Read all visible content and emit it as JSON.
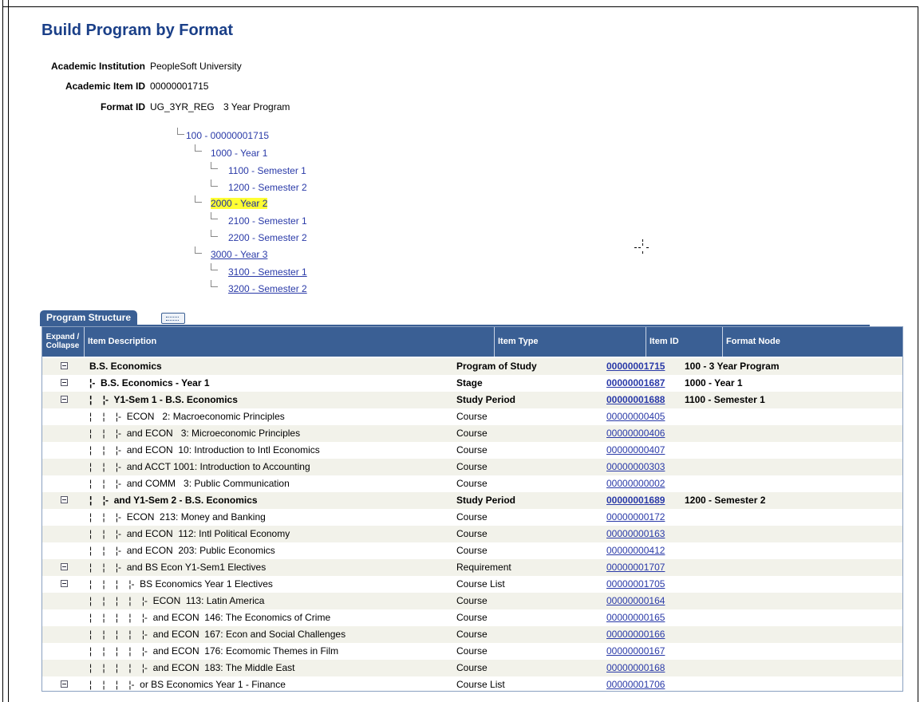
{
  "page": {
    "title": "Build Program by Format"
  },
  "fields": {
    "institution": {
      "label": "Academic Institution",
      "value": "PeopleSoft University"
    },
    "item_id": {
      "label": "Academic Item ID",
      "value": "00000001715"
    },
    "format_id": {
      "label": "Format ID",
      "value": "UG_3YR_REG",
      "description": "3 Year Program"
    }
  },
  "tree": [
    {
      "label": "100 - 00000001715"
    },
    {
      "label": "1000 - Year 1"
    },
    {
      "label": "1100 - Semester 1"
    },
    {
      "label": "1200 - Semester 2"
    },
    {
      "label": "2000 - Year 2"
    },
    {
      "label": "2100 - Semester 1"
    },
    {
      "label": "2200 - Semester 2"
    },
    {
      "label": "3000 - Year 3"
    },
    {
      "label": "3100 - Semester 1"
    },
    {
      "label": "3200 - Semester 2"
    }
  ],
  "tabs": {
    "active": "Program Structure"
  },
  "grid": {
    "columns": [
      "Expand / Collapse",
      "Item Description",
      "Item Type",
      "Item ID",
      "Format Node"
    ],
    "rows": [
      {
        "expand": true,
        "desc": "B.S. Economics",
        "type": "Program of Study",
        "id": "00000001715",
        "node": "100 - 3 Year Program",
        "bold": true
      },
      {
        "expand": true,
        "desc": "¦-  B.S. Economics - Year 1",
        "type": "Stage",
        "id": "00000001687",
        "node": "1000 - Year 1",
        "bold": true
      },
      {
        "expand": true,
        "desc": "¦    ¦-  Y1-Sem 1 - B.S. Economics",
        "type": "Study Period",
        "id": "00000001688",
        "node": "1100 - Semester 1",
        "bold": true
      },
      {
        "expand": false,
        "desc": "¦    ¦    ¦-  ECON   2: Macroeconomic Principles",
        "type": "Course",
        "id": "00000000405",
        "node": "",
        "bold": false
      },
      {
        "expand": false,
        "desc": "¦    ¦    ¦-  and ECON   3: Microeconomic Principles",
        "type": "Course",
        "id": "00000000406",
        "node": "",
        "bold": false
      },
      {
        "expand": false,
        "desc": "¦    ¦    ¦-  and ECON  10: Introduction to Intl Economics",
        "type": "Course",
        "id": "00000000407",
        "node": "",
        "bold": false
      },
      {
        "expand": false,
        "desc": "¦    ¦    ¦-  and ACCT 1001: Introduction to Accounting",
        "type": "Course",
        "id": "00000000303",
        "node": "",
        "bold": false
      },
      {
        "expand": false,
        "desc": "¦    ¦    ¦-  and COMM   3: Public Communication",
        "type": "Course",
        "id": "00000000002",
        "node": "",
        "bold": false
      },
      {
        "expand": true,
        "desc": "¦    ¦-  and Y1-Sem 2 - B.S. Economics",
        "type": "Study Period",
        "id": "00000001689",
        "node": "1200 - Semester 2",
        "bold": true
      },
      {
        "expand": false,
        "desc": "¦    ¦    ¦-  ECON  213: Money and Banking",
        "type": "Course",
        "id": "00000000172",
        "node": "",
        "bold": false
      },
      {
        "expand": false,
        "desc": "¦    ¦    ¦-  and ECON  112: Intl Political Economy",
        "type": "Course",
        "id": "00000000163",
        "node": "",
        "bold": false
      },
      {
        "expand": false,
        "desc": "¦    ¦    ¦-  and ECON  203: Public Economics",
        "type": "Course",
        "id": "00000000412",
        "node": "",
        "bold": false
      },
      {
        "expand": true,
        "desc": "¦    ¦    ¦-  and BS Econ Y1-Sem1 Electives",
        "type": "Requirement",
        "id": "00000001707",
        "node": "",
        "bold": false
      },
      {
        "expand": true,
        "desc": "¦    ¦    ¦    ¦-  BS Economics Year 1 Electives",
        "type": "Course List",
        "id": "00000001705",
        "node": "",
        "bold": false
      },
      {
        "expand": false,
        "desc": "¦    ¦    ¦    ¦    ¦-  ECON  113: Latin America",
        "type": "Course",
        "id": "00000000164",
        "node": "",
        "bold": false
      },
      {
        "expand": false,
        "desc": "¦    ¦    ¦    ¦    ¦-  and ECON  146: The Economics of Crime",
        "type": "Course",
        "id": "00000000165",
        "node": "",
        "bold": false
      },
      {
        "expand": false,
        "desc": "¦    ¦    ¦    ¦    ¦-  and ECON  167: Econ and Social Challenges",
        "type": "Course",
        "id": "00000000166",
        "node": "",
        "bold": false
      },
      {
        "expand": false,
        "desc": "¦    ¦    ¦    ¦    ¦-  and ECON  176: Ecomomic Themes in Film",
        "type": "Course",
        "id": "00000000167",
        "node": "",
        "bold": false
      },
      {
        "expand": false,
        "desc": "¦    ¦    ¦    ¦    ¦-  and ECON  183: The Middle East",
        "type": "Course",
        "id": "00000000168",
        "node": "",
        "bold": false
      },
      {
        "expand": true,
        "desc": "¦    ¦    ¦    ¦-  or BS Economics Year 1 - Finance",
        "type": "Course List",
        "id": "00000001706",
        "node": "",
        "bold": false
      }
    ]
  }
}
